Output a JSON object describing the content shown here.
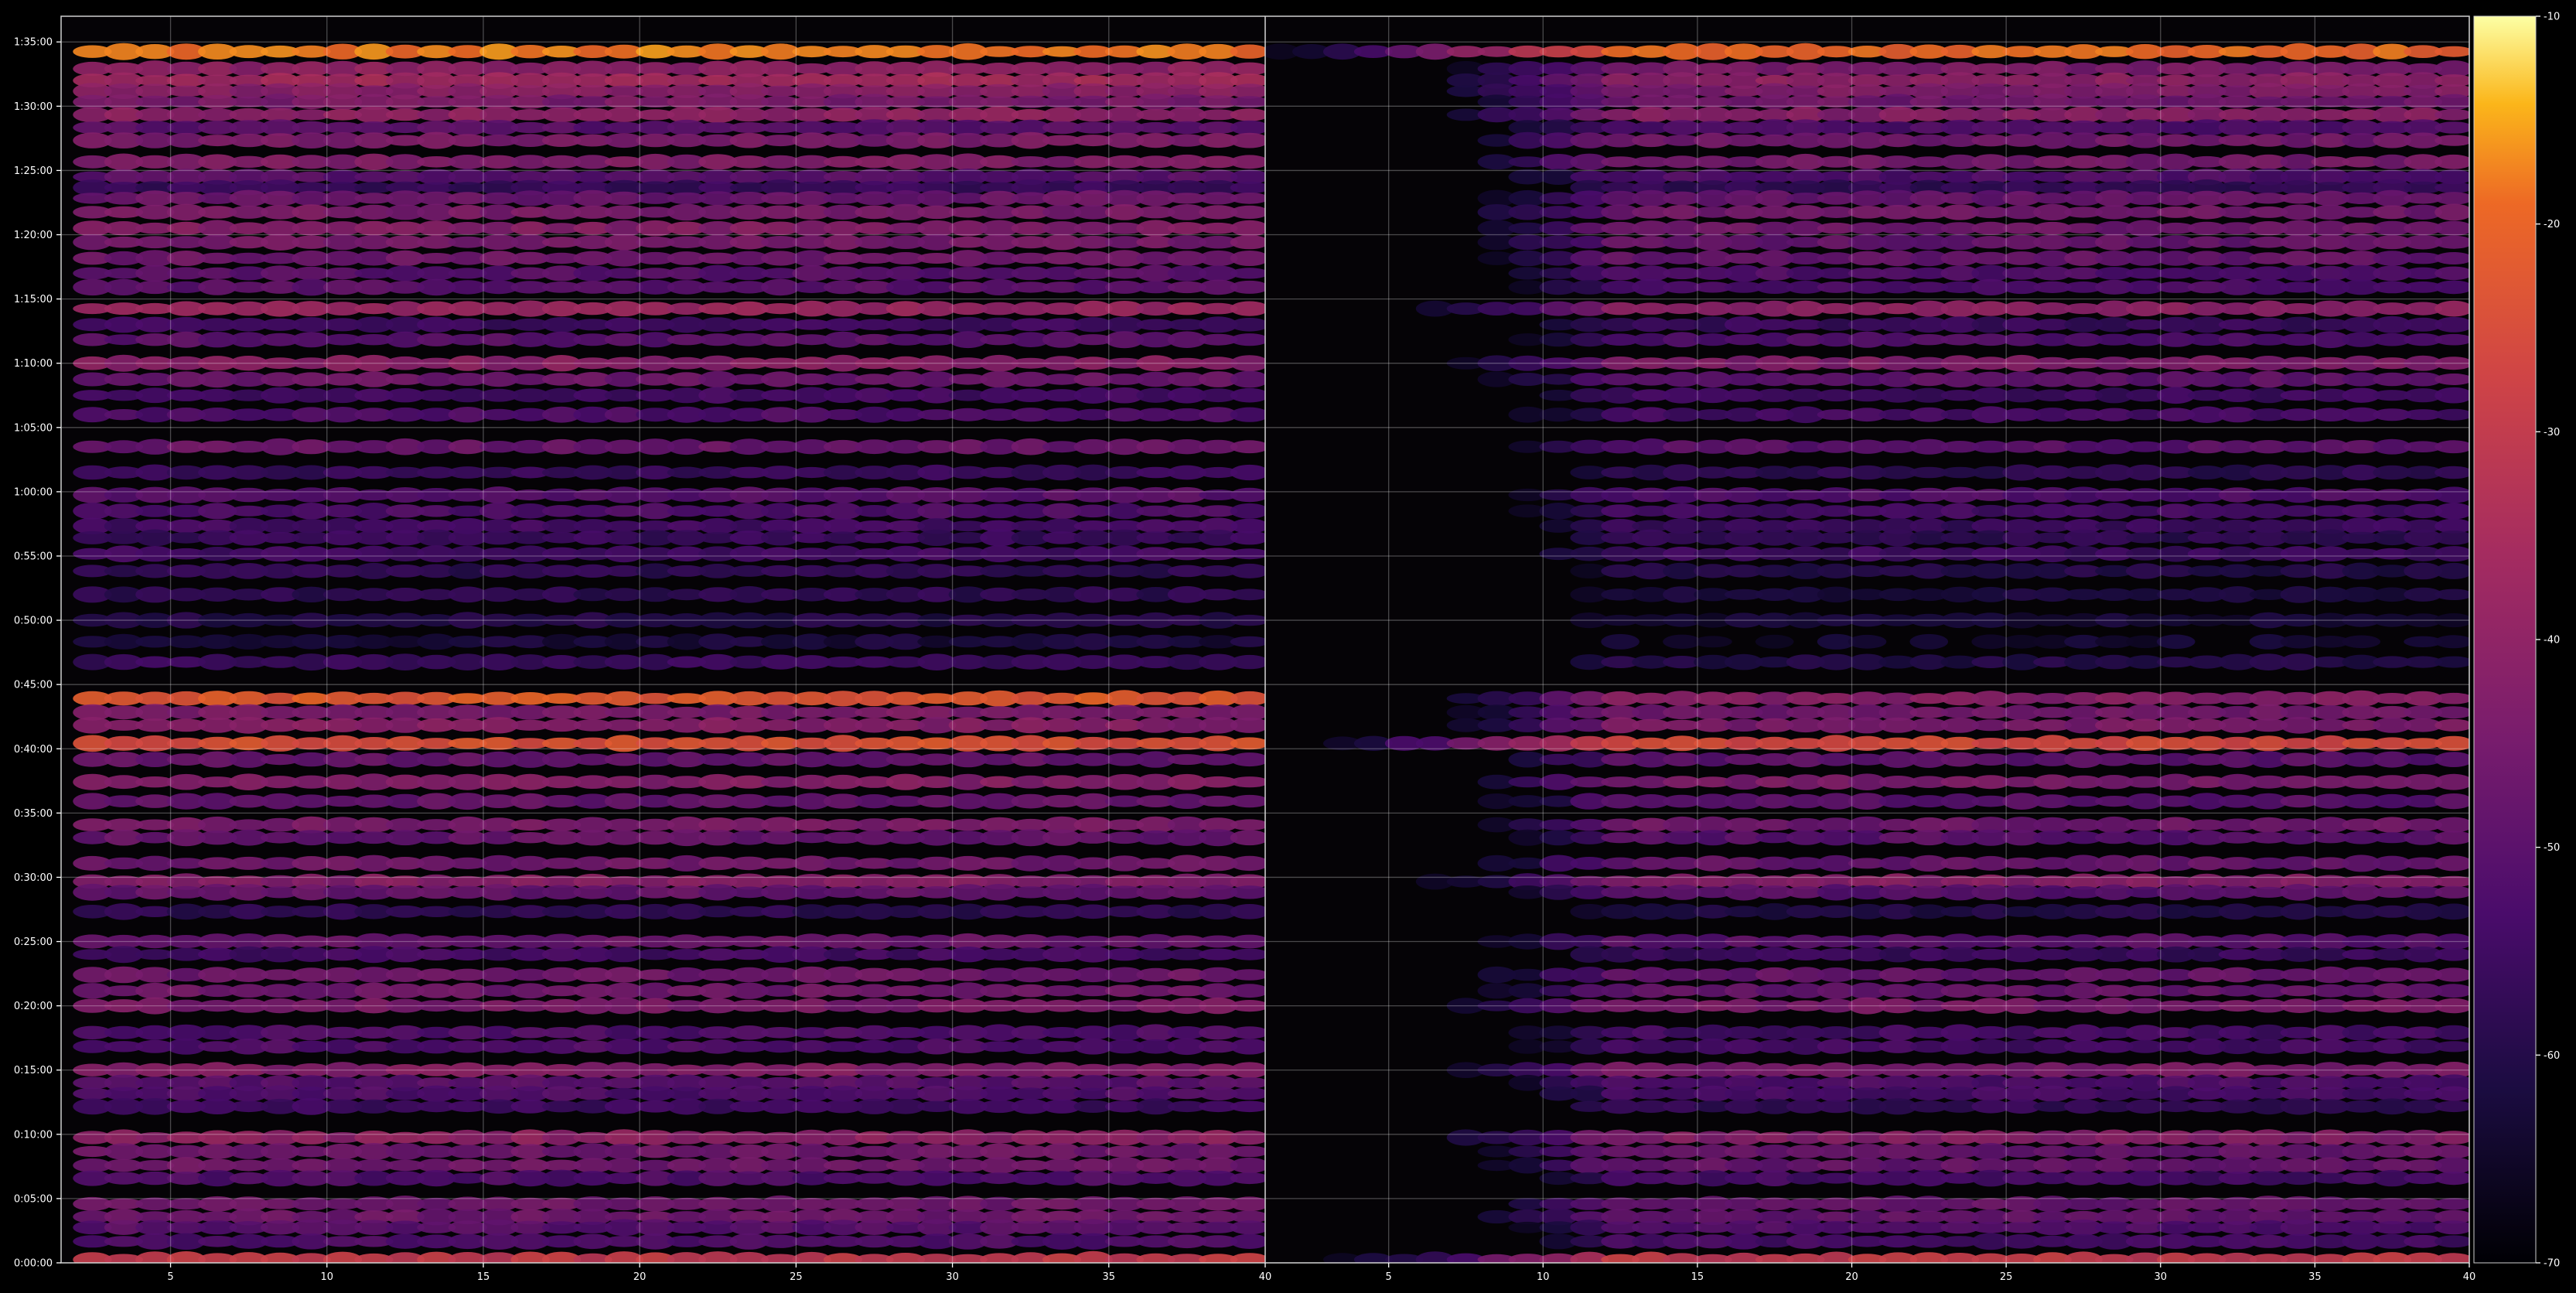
{
  "chart_data": {
    "type": "heatmap",
    "title": "",
    "colormap": "inferno",
    "y_axis": {
      "label": "",
      "range_seconds": [
        0,
        5820
      ],
      "ticks": [
        {
          "value": 0,
          "label": "0:00:00"
        },
        {
          "value": 300,
          "label": "0:05:00"
        },
        {
          "value": 600,
          "label": "0:10:00"
        },
        {
          "value": 900,
          "label": "0:15:00"
        },
        {
          "value": 1200,
          "label": "0:20:00"
        },
        {
          "value": 1500,
          "label": "0:25:00"
        },
        {
          "value": 1800,
          "label": "0:30:00"
        },
        {
          "value": 2100,
          "label": "0:35:00"
        },
        {
          "value": 2400,
          "label": "0:40:00"
        },
        {
          "value": 2700,
          "label": "0:45:00"
        },
        {
          "value": 3000,
          "label": "0:50:00"
        },
        {
          "value": 3300,
          "label": "0:55:00"
        },
        {
          "value": 3600,
          "label": "1:00:00"
        },
        {
          "value": 3900,
          "label": "1:05:00"
        },
        {
          "value": 4200,
          "label": "1:10:00"
        },
        {
          "value": 4500,
          "label": "1:15:00"
        },
        {
          "value": 4800,
          "label": "1:20:00"
        },
        {
          "value": 5100,
          "label": "1:25:00"
        },
        {
          "value": 5400,
          "label": "1:30:00"
        },
        {
          "value": 5700,
          "label": "1:35:00"
        }
      ]
    },
    "colorbar": {
      "range": [
        -70,
        -10
      ],
      "ticks": [
        -10,
        -20,
        -30,
        -40,
        -50,
        -60,
        -70
      ]
    },
    "panels": [
      {
        "name": "left",
        "x_range": [
          1.5,
          40
        ],
        "x_ticks": [
          5,
          10,
          15,
          20,
          25,
          30,
          35,
          40
        ],
        "columns_from": 2,
        "columns_to": 39,
        "bands": [
          {
            "t": 5655,
            "db": -18
          },
          {
            "t": 5575,
            "db": -40
          },
          {
            "t": 5520,
            "db": -36
          },
          {
            "t": 5470,
            "db": -41
          },
          {
            "t": 5420,
            "db": -44
          },
          {
            "t": 5360,
            "db": -40
          },
          {
            "t": 5300,
            "db": -50
          },
          {
            "t": 5240,
            "db": -44
          },
          {
            "t": 5140,
            "db": -43
          },
          {
            "t": 5070,
            "db": -50
          },
          {
            "t": 5020,
            "db": -56
          },
          {
            "t": 4970,
            "db": -47
          },
          {
            "t": 4905,
            "db": -44
          },
          {
            "t": 4830,
            "db": -42
          },
          {
            "t": 4765,
            "db": -45
          },
          {
            "t": 4690,
            "db": -46
          },
          {
            "t": 4620,
            "db": -50
          },
          {
            "t": 4555,
            "db": -50
          },
          {
            "t": 4455,
            "db": -38
          },
          {
            "t": 4380,
            "db": -55
          },
          {
            "t": 4310,
            "db": -50
          },
          {
            "t": 4200,
            "db": -41
          },
          {
            "t": 4125,
            "db": -47
          },
          {
            "t": 4050,
            "db": -54
          },
          {
            "t": 3960,
            "db": -52
          },
          {
            "t": 3810,
            "db": -47
          },
          {
            "t": 3690,
            "db": -56
          },
          {
            "t": 3585,
            "db": -50
          },
          {
            "t": 3510,
            "db": -52
          },
          {
            "t": 3440,
            "db": -54
          },
          {
            "t": 3385,
            "db": -56
          },
          {
            "t": 3310,
            "db": -54
          },
          {
            "t": 3230,
            "db": -58
          },
          {
            "t": 3120,
            "db": -58
          },
          {
            "t": 3000,
            "db": -60
          },
          {
            "t": 2900,
            "db": -62
          },
          {
            "t": 2805,
            "db": -56
          },
          {
            "t": 2635,
            "db": -22
          },
          {
            "t": 2570,
            "db": -44
          },
          {
            "t": 2510,
            "db": -42
          },
          {
            "t": 2425,
            "db": -24
          },
          {
            "t": 2350,
            "db": -48
          },
          {
            "t": 2245,
            "db": -42
          },
          {
            "t": 2155,
            "db": -48
          },
          {
            "t": 2045,
            "db": -44
          },
          {
            "t": 1985,
            "db": -48
          },
          {
            "t": 1865,
            "db": -46
          },
          {
            "t": 1780,
            "db": -42
          },
          {
            "t": 1730,
            "db": -48
          },
          {
            "t": 1640,
            "db": -58
          },
          {
            "t": 1500,
            "db": -47
          },
          {
            "t": 1440,
            "db": -54
          },
          {
            "t": 1345,
            "db": -46
          },
          {
            "t": 1270,
            "db": -46
          },
          {
            "t": 1200,
            "db": -44
          },
          {
            "t": 1075,
            "db": -52
          },
          {
            "t": 1010,
            "db": -52
          },
          {
            "t": 900,
            "db": -42
          },
          {
            "t": 840,
            "db": -50
          },
          {
            "t": 790,
            "db": -52
          },
          {
            "t": 730,
            "db": -55
          },
          {
            "t": 585,
            "db": -40
          },
          {
            "t": 520,
            "db": -46
          },
          {
            "t": 455,
            "db": -46
          },
          {
            "t": 395,
            "db": -52
          },
          {
            "t": 275,
            "db": -46
          },
          {
            "t": 215,
            "db": -46
          },
          {
            "t": 165,
            "db": -50
          },
          {
            "t": 100,
            "db": -52
          },
          {
            "t": 15,
            "db": -30
          }
        ]
      },
      {
        "name": "right",
        "x_range": [
          1,
          40
        ],
        "x_ticks": [
          5,
          10,
          15,
          20,
          25,
          30,
          35,
          40
        ],
        "columns_from": 1,
        "columns_to": 39,
        "bands": [
          {
            "t": 5655,
            "db": -20
          },
          {
            "t": 5575,
            "db": -44
          },
          {
            "t": 5520,
            "db": -40
          },
          {
            "t": 5470,
            "db": -43
          },
          {
            "t": 5420,
            "db": -46
          },
          {
            "t": 5360,
            "db": -42
          },
          {
            "t": 5300,
            "db": -52
          },
          {
            "t": 5240,
            "db": -46
          },
          {
            "t": 5140,
            "db": -45
          },
          {
            "t": 5070,
            "db": -52
          },
          {
            "t": 5020,
            "db": -57
          },
          {
            "t": 4970,
            "db": -48
          },
          {
            "t": 4905,
            "db": -46
          },
          {
            "t": 4830,
            "db": -46
          },
          {
            "t": 4765,
            "db": -48
          },
          {
            "t": 4690,
            "db": -48
          },
          {
            "t": 4620,
            "db": -52
          },
          {
            "t": 4555,
            "db": -52
          },
          {
            "t": 4455,
            "db": -40
          },
          {
            "t": 4380,
            "db": -56
          },
          {
            "t": 4310,
            "db": -52
          },
          {
            "t": 4200,
            "db": -43
          },
          {
            "t": 4125,
            "db": -49
          },
          {
            "t": 4050,
            "db": -55
          },
          {
            "t": 3960,
            "db": -54
          },
          {
            "t": 3810,
            "db": -50
          },
          {
            "t": 3690,
            "db": -58
          },
          {
            "t": 3585,
            "db": -52
          },
          {
            "t": 3510,
            "db": -54
          },
          {
            "t": 3440,
            "db": -56
          },
          {
            "t": 3385,
            "db": -58
          },
          {
            "t": 3310,
            "db": -55
          },
          {
            "t": 3230,
            "db": -60
          },
          {
            "t": 3120,
            "db": -62
          },
          {
            "t": 3000,
            "db": -63
          },
          {
            "t": 2900,
            "db": -64
          },
          {
            "t": 2805,
            "db": -60
          },
          {
            "t": 2635,
            "db": -42
          },
          {
            "t": 2570,
            "db": -46
          },
          {
            "t": 2510,
            "db": -44
          },
          {
            "t": 2425,
            "db": -26
          },
          {
            "t": 2350,
            "db": -50
          },
          {
            "t": 2245,
            "db": -44
          },
          {
            "t": 2155,
            "db": -50
          },
          {
            "t": 2045,
            "db": -46
          },
          {
            "t": 1985,
            "db": -50
          },
          {
            "t": 1865,
            "db": -48
          },
          {
            "t": 1780,
            "db": -42
          },
          {
            "t": 1730,
            "db": -50
          },
          {
            "t": 1640,
            "db": -60
          },
          {
            "t": 1500,
            "db": -50
          },
          {
            "t": 1440,
            "db": -56
          },
          {
            "t": 1345,
            "db": -48
          },
          {
            "t": 1270,
            "db": -48
          },
          {
            "t": 1200,
            "db": -44
          },
          {
            "t": 1075,
            "db": -54
          },
          {
            "t": 1010,
            "db": -54
          },
          {
            "t": 900,
            "db": -44
          },
          {
            "t": 840,
            "db": -52
          },
          {
            "t": 790,
            "db": -54
          },
          {
            "t": 730,
            "db": -57
          },
          {
            "t": 585,
            "db": -42
          },
          {
            "t": 520,
            "db": -48
          },
          {
            "t": 455,
            "db": -48
          },
          {
            "t": 395,
            "db": -54
          },
          {
            "t": 275,
            "db": -48
          },
          {
            "t": 215,
            "db": -48
          },
          {
            "t": 165,
            "db": -52
          },
          {
            "t": 100,
            "db": -54
          },
          {
            "t": 15,
            "db": -30
          }
        ]
      }
    ]
  }
}
